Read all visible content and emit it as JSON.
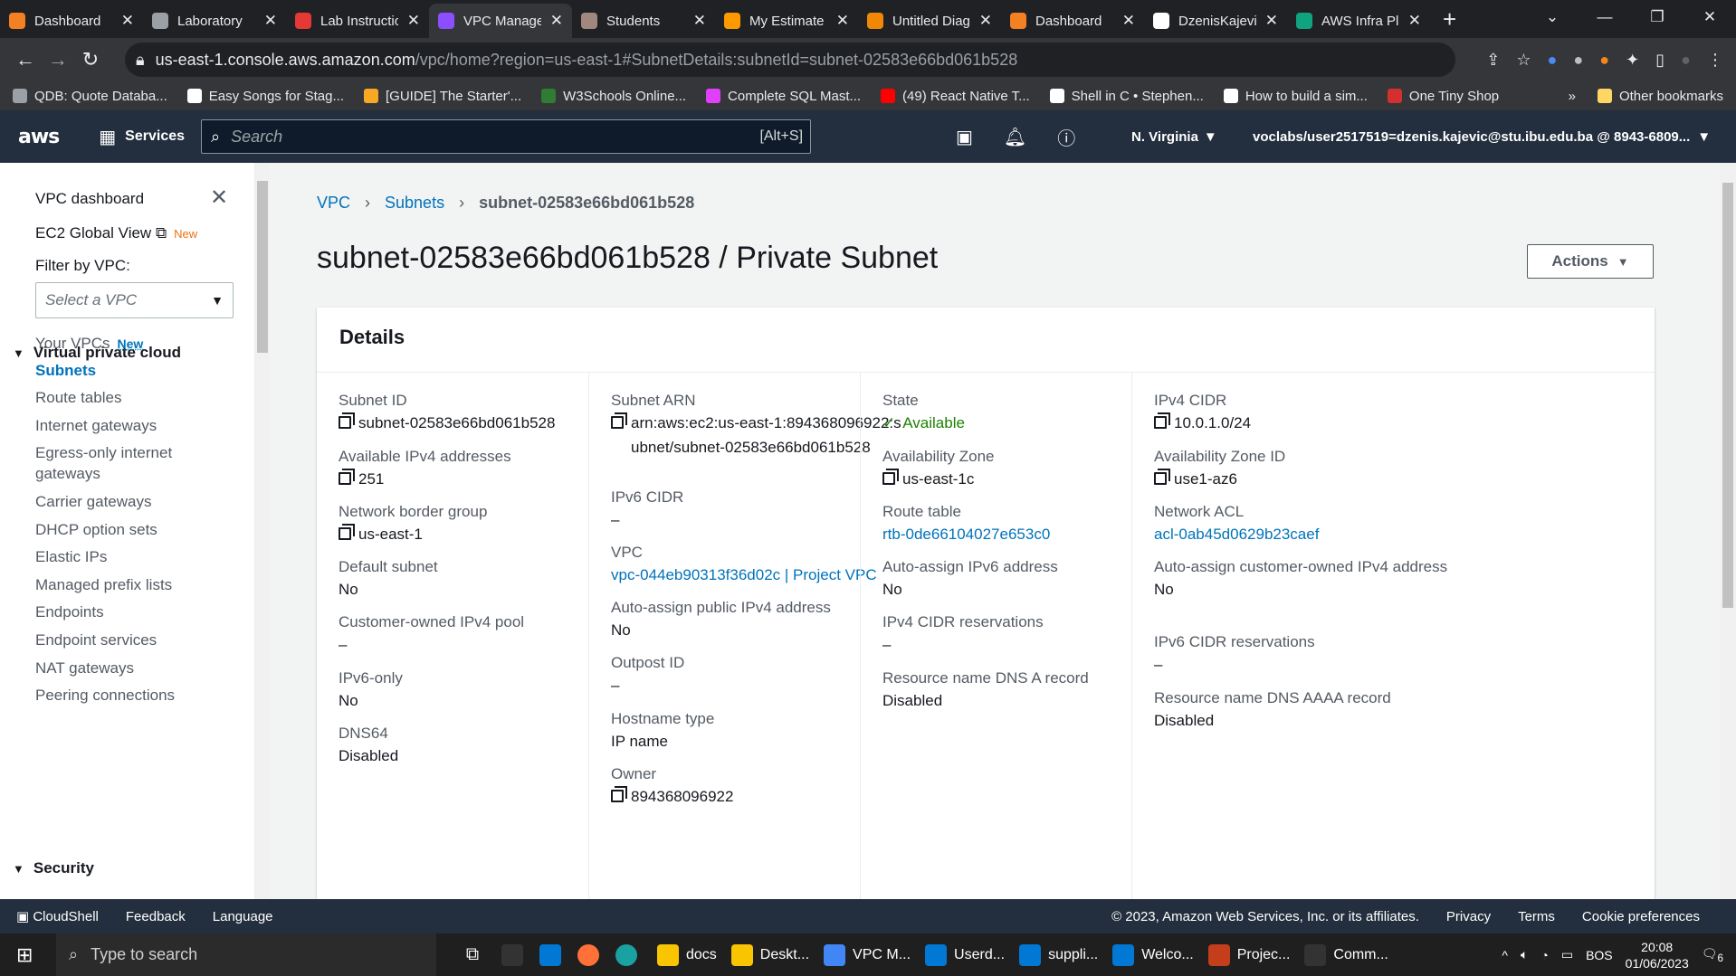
{
  "browser": {
    "tabs": [
      {
        "title": "Dashboard",
        "color": "#f48024"
      },
      {
        "title": "Laboratory",
        "color": "#9aa0a6"
      },
      {
        "title": "Lab Instructions",
        "color": "#e53935"
      },
      {
        "title": "VPC Management",
        "color": "#8c4fff"
      },
      {
        "title": "Students",
        "color": "#a1887f"
      },
      {
        "title": "My Estimate",
        "color": "#ff9900"
      },
      {
        "title": "Untitled Diagram",
        "color": "#f08705"
      },
      {
        "title": "Dashboard",
        "color": "#f48024"
      },
      {
        "title": "DzenisKajevic",
        "color": "#ffffff"
      },
      {
        "title": "AWS Infra Plan",
        "color": "#10a37f"
      }
    ],
    "url_host": "us-east-1.console.aws.amazon.com",
    "url_path": "/vpc/home?region=us-east-1#SubnetDetails:subnetId=subnet-02583e66bd061b528",
    "bookmarks": [
      "QDB: Quote Databa...",
      "Easy Songs for Stag...",
      "[GUIDE] The Starter'...",
      "W3Schools Online...",
      "Complete SQL Mast...",
      "(49) React Native T...",
      "Shell in C • Stephen...",
      "How to build a sim...",
      "One Tiny Shop"
    ],
    "other_bookmarks": "Other bookmarks"
  },
  "aws": {
    "logo": "aws",
    "services": "Services",
    "search_placeholder": "Search",
    "search_shortcut": "[Alt+S]",
    "region": "N. Virginia",
    "account": "voclabs/user2517519=dzenis.kajevic@stu.ibu.edu.ba @ 8943-6809..."
  },
  "sidebar": {
    "dashboard": "VPC dashboard",
    "ec2_global": "EC2 Global View",
    "new": "New",
    "filter_label": "Filter by VPC:",
    "filter_placeholder": "Select a VPC",
    "section_vpc": "Virtual private cloud",
    "items": [
      "Your VPCs",
      "Subnets",
      "Route tables",
      "Internet gateways",
      "Egress-only internet",
      "gateways",
      "Carrier gateways",
      "DHCP option sets",
      "Elastic IPs",
      "Managed prefix lists",
      "Endpoints",
      "Endpoint services",
      "NAT gateways",
      "Peering connections"
    ],
    "section_security": "Security"
  },
  "main": {
    "breadcrumb": [
      "VPC",
      "Subnets",
      "subnet-02583e66bd061b528"
    ],
    "title": "subnet-02583e66bd061b528 / Private Subnet",
    "actions": "Actions",
    "details_title": "Details",
    "col1": [
      {
        "label": "Subnet ID",
        "value": "subnet-02583e66bd061b528"
      },
      {
        "label": "Available IPv4 addresses",
        "value": "251"
      },
      {
        "label": "Network border group",
        "value": "us-east-1"
      },
      {
        "label": "Default subnet",
        "value": "No"
      },
      {
        "label": "Customer-owned IPv4 pool",
        "value": "–"
      },
      {
        "label": "IPv6-only",
        "value": "No"
      },
      {
        "label": "DNS64",
        "value": "Disabled"
      }
    ],
    "col2": [
      {
        "label": "Subnet ARN",
        "value": "arn:aws:ec2:us-east-1:894368096922:subnet/subnet-02583e66bd061b528"
      },
      {
        "label": "IPv6 CIDR",
        "value": "–"
      },
      {
        "label": "VPC",
        "value": "vpc-044eb90313f36d02c | Project VPC"
      },
      {
        "label": "Auto-assign public IPv4 address",
        "value": "No"
      },
      {
        "label": "Outpost ID",
        "value": "–"
      },
      {
        "label": "Hostname type",
        "value": "IP name"
      },
      {
        "label": "Owner",
        "value": "894368096922"
      }
    ],
    "col3": [
      {
        "label": "State",
        "value": "Available"
      },
      {
        "label": "Availability Zone",
        "value": "us-east-1c"
      },
      {
        "label": "Route table",
        "value": "rtb-0de66104027e653c0"
      },
      {
        "label": "Auto-assign IPv6 address",
        "value": "No"
      },
      {
        "label": "IPv4 CIDR reservations",
        "value": "–"
      },
      {
        "label": "Resource name DNS A record",
        "value": "Disabled"
      }
    ],
    "col4": [
      {
        "label": "IPv4 CIDR",
        "value": "10.0.1.0/24"
      },
      {
        "label": "Availability Zone ID",
        "value": "use1-az6"
      },
      {
        "label": "Network ACL",
        "value": "acl-0ab45d0629b23caef"
      },
      {
        "label": "Auto-assign customer-owned IPv4 address",
        "value": "No"
      },
      {
        "label": "IPv6 CIDR reservations",
        "value": "–"
      },
      {
        "label": "Resource name DNS AAAA record",
        "value": "Disabled"
      }
    ]
  },
  "footer": {
    "cloudshell": "CloudShell",
    "feedback": "Feedback",
    "language": "Language",
    "copyright": "© 2023, Amazon Web Services, Inc. or its affiliates.",
    "privacy": "Privacy",
    "terms": "Terms",
    "cookies": "Cookie preferences"
  },
  "taskbar": {
    "search": "Type to search",
    "apps": [
      "docs",
      "Deskt...",
      "VPC M...",
      "Userd...",
      "suppli...",
      "Welco...",
      "Projec...",
      "Comm..."
    ],
    "lang": "BOS",
    "time": "20:08",
    "date": "01/06/2023",
    "notif": "6"
  }
}
